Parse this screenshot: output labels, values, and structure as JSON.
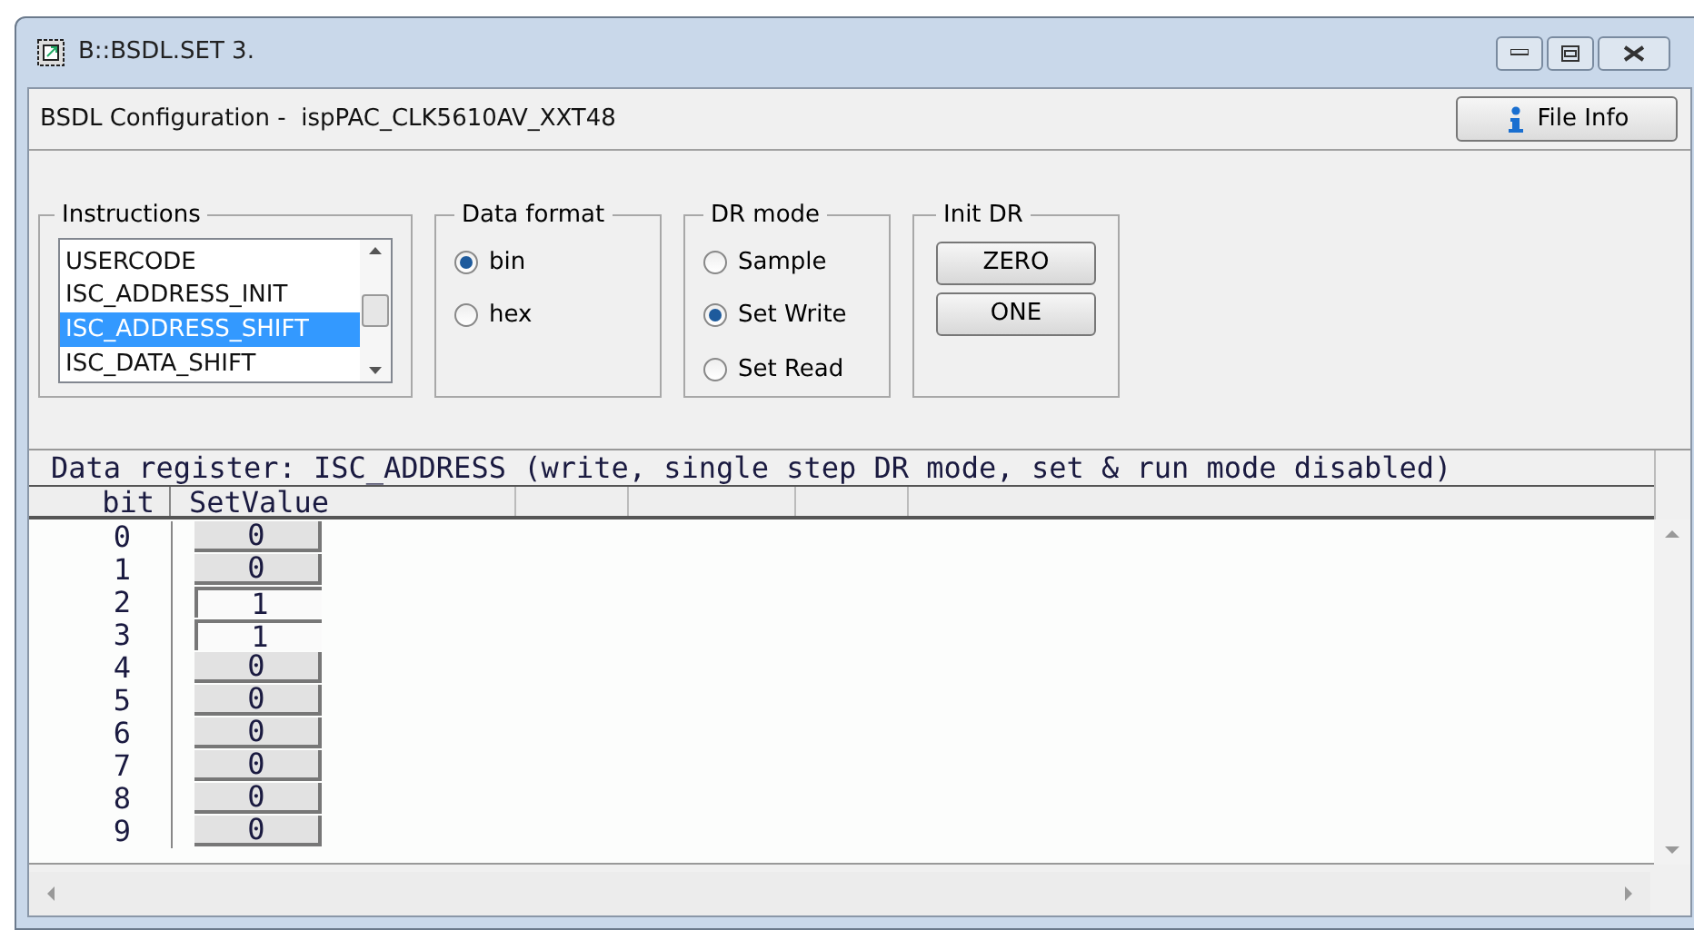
{
  "window": {
    "title": "B::BSDL.SET 3."
  },
  "header": {
    "label": "BSDL Configuration -  ispPAC_CLK5610AV_XXT48",
    "file_info_button": "File Info"
  },
  "instructions": {
    "title": "Instructions",
    "items": [
      {
        "label": "USERCODE",
        "selected": false
      },
      {
        "label": "ISC_ADDRESS_INIT",
        "selected": false
      },
      {
        "label": "ISC_ADDRESS_SHIFT",
        "selected": true
      },
      {
        "label": "ISC_DATA_SHIFT",
        "selected": false
      }
    ]
  },
  "data_format": {
    "title": "Data format",
    "options": [
      {
        "label": "bin",
        "selected": true
      },
      {
        "label": "hex",
        "selected": false
      }
    ]
  },
  "dr_mode": {
    "title": "DR mode",
    "options": [
      {
        "label": "Sample",
        "selected": false
      },
      {
        "label": "Set Write",
        "selected": true
      },
      {
        "label": "Set Read",
        "selected": false
      }
    ]
  },
  "init_dr": {
    "title": "Init DR",
    "buttons": [
      "ZERO",
      "ONE"
    ]
  },
  "register": {
    "caption": "Data register: ISC_ADDRESS (write, single step DR mode, set & run mode disabled)",
    "columns": [
      "bit",
      "SetValue"
    ],
    "rows": [
      {
        "bit": "0",
        "value": "0",
        "pressed": false
      },
      {
        "bit": "1",
        "value": "0",
        "pressed": false
      },
      {
        "bit": "2",
        "value": "1",
        "pressed": true
      },
      {
        "bit": "3",
        "value": "1",
        "pressed": true
      },
      {
        "bit": "4",
        "value": "0",
        "pressed": false
      },
      {
        "bit": "5",
        "value": "0",
        "pressed": false
      },
      {
        "bit": "6",
        "value": "0",
        "pressed": false
      },
      {
        "bit": "7",
        "value": "0",
        "pressed": false
      },
      {
        "bit": "8",
        "value": "0",
        "pressed": false
      },
      {
        "bit": "9",
        "value": "0",
        "pressed": false
      }
    ]
  }
}
